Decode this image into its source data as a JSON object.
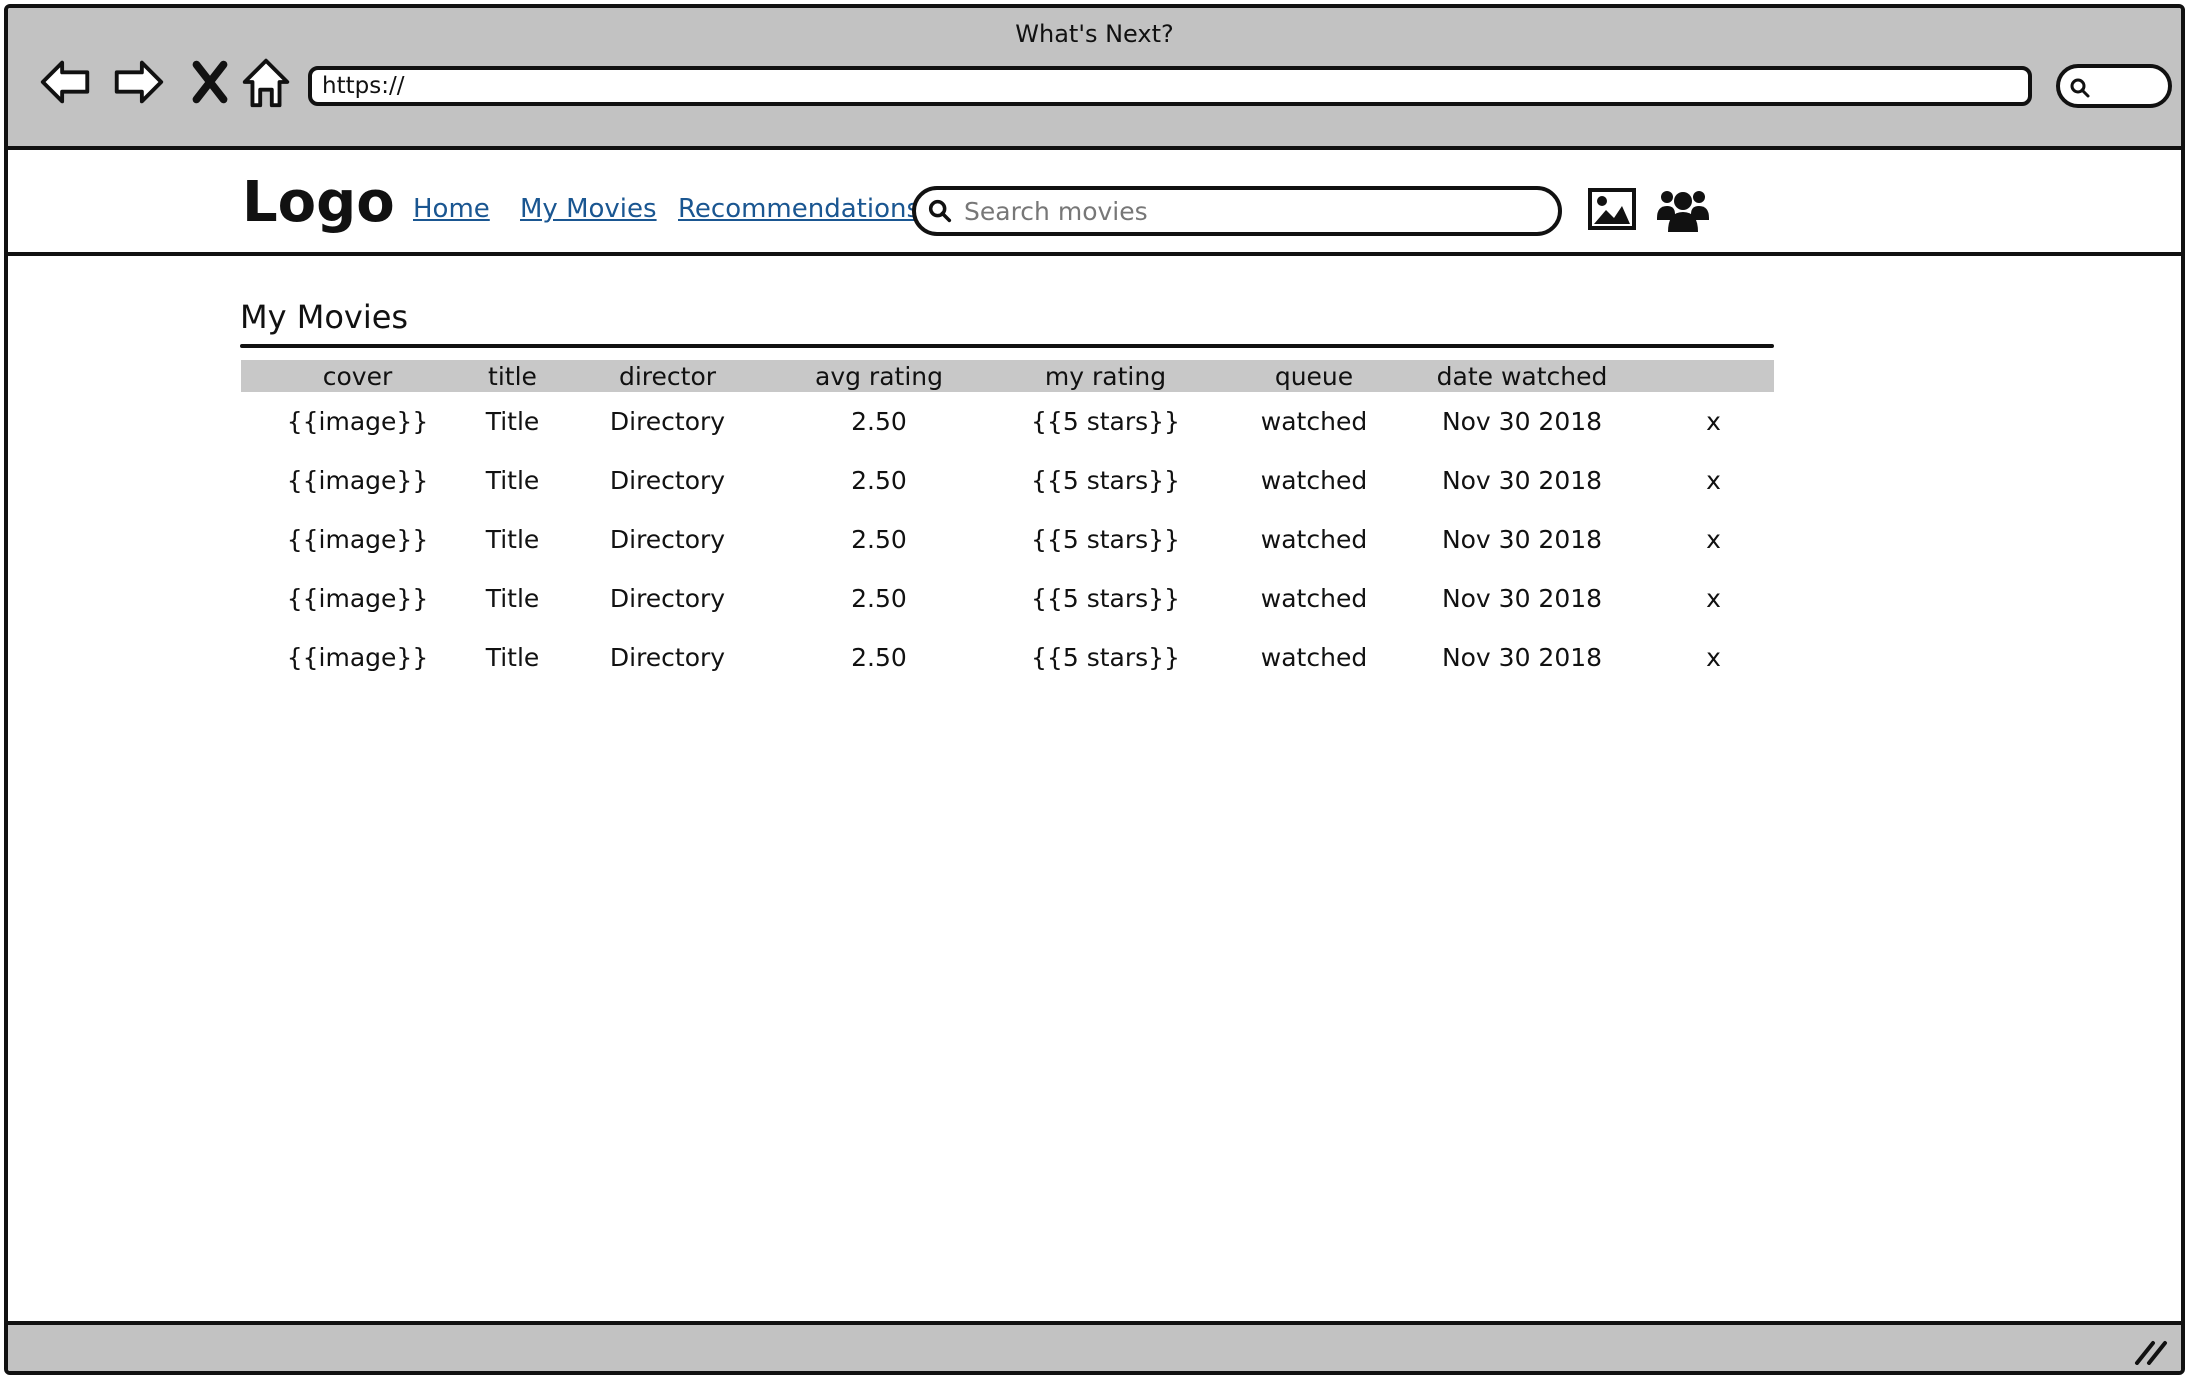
{
  "window": {
    "title": "What's Next?"
  },
  "browser": {
    "url": "https://",
    "icons": [
      "back-arrow-icon",
      "forward-arrow-icon",
      "stop-icon",
      "home-icon",
      "search-icon"
    ]
  },
  "header": {
    "logo": "Logo",
    "nav": [
      {
        "label": "Home"
      },
      {
        "label": "My Movies"
      },
      {
        "label": "Recommendations"
      }
    ],
    "search": {
      "placeholder": "Search movies",
      "value": ""
    },
    "icons": [
      "image-icon",
      "users-icon"
    ],
    "link_color": "#1a5691"
  },
  "main": {
    "title": "My Movies",
    "table": {
      "columns": [
        "cover",
        "title",
        "director",
        "avg rating",
        "my rating",
        "queue",
        "date watched",
        ""
      ],
      "rows": [
        {
          "cover": "{{image}}",
          "title": "Title",
          "director": "Directory",
          "avg_rating": "2.50",
          "my_rating": "{{5 stars}}",
          "queue": "watched",
          "date_watched": "Nov 30 2018",
          "remove": "x"
        },
        {
          "cover": "{{image}}",
          "title": "Title",
          "director": "Directory",
          "avg_rating": "2.50",
          "my_rating": "{{5 stars}}",
          "queue": "watched",
          "date_watched": "Nov 30 2018",
          "remove": "x"
        },
        {
          "cover": "{{image}}",
          "title": "Title",
          "director": "Directory",
          "avg_rating": "2.50",
          "my_rating": "{{5 stars}}",
          "queue": "watched",
          "date_watched": "Nov 30 2018",
          "remove": "x"
        },
        {
          "cover": "{{image}}",
          "title": "Title",
          "director": "Directory",
          "avg_rating": "2.50",
          "my_rating": "{{5 stars}}",
          "queue": "watched",
          "date_watched": "Nov 30 2018",
          "remove": "x"
        },
        {
          "cover": "{{image}}",
          "title": "Title",
          "director": "Directory",
          "avg_rating": "2.50",
          "my_rating": "{{5 stars}}",
          "queue": "watched",
          "date_watched": "Nov 30 2018",
          "remove": "x"
        }
      ]
    }
  },
  "colors": {
    "chrome": "#c2c2c2",
    "table_header": "#c8c8c8",
    "border": "#111111"
  }
}
